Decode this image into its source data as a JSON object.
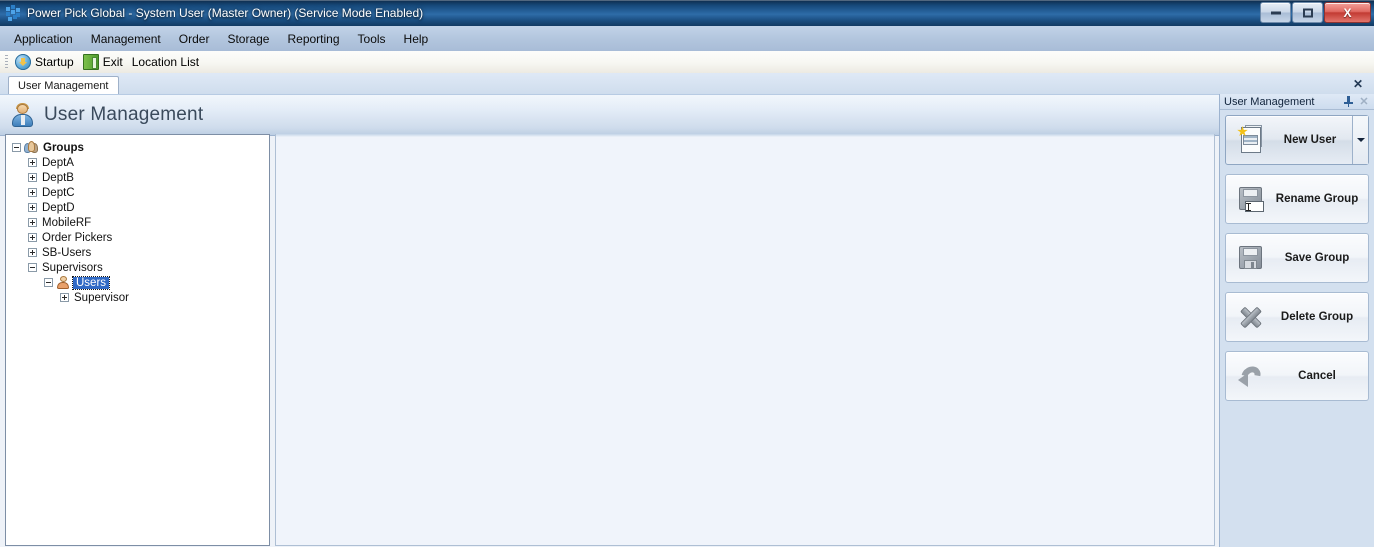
{
  "window": {
    "title": "Power Pick Global - System User (Master Owner) (Service Mode Enabled)",
    "icon": "app-grid-icon",
    "controls": {
      "minimize": "minimize-button",
      "maximize": "restore-button",
      "close_label": "X"
    }
  },
  "menubar": {
    "items": [
      {
        "label": "Application"
      },
      {
        "label": "Management"
      },
      {
        "label": "Order"
      },
      {
        "label": "Storage"
      },
      {
        "label": "Reporting"
      },
      {
        "label": "Tools"
      },
      {
        "label": "Help"
      }
    ]
  },
  "toolbar": {
    "items": [
      {
        "label": "Startup",
        "icon": "startup-icon"
      },
      {
        "label": "Exit",
        "icon": "exit-door-icon"
      },
      {
        "label": "Location List",
        "icon": "none"
      }
    ]
  },
  "tabs": {
    "items": [
      {
        "label": "User Management",
        "active": true
      }
    ],
    "close_label": "✕"
  },
  "page_header": {
    "title": "User Management",
    "icon": "user-avatar-icon"
  },
  "tree": {
    "nodes": [
      {
        "label": "Groups",
        "indent": 0,
        "expander": "minus",
        "icon": "groups-icon",
        "bold": true,
        "selected": false
      },
      {
        "label": "DeptA",
        "indent": 1,
        "expander": "plus",
        "icon": "none",
        "bold": false,
        "selected": false
      },
      {
        "label": "DeptB",
        "indent": 1,
        "expander": "plus",
        "icon": "none",
        "bold": false,
        "selected": false
      },
      {
        "label": "DeptC",
        "indent": 1,
        "expander": "plus",
        "icon": "none",
        "bold": false,
        "selected": false
      },
      {
        "label": "DeptD",
        "indent": 1,
        "expander": "plus",
        "icon": "none",
        "bold": false,
        "selected": false
      },
      {
        "label": "MobileRF",
        "indent": 1,
        "expander": "plus",
        "icon": "none",
        "bold": false,
        "selected": false
      },
      {
        "label": "Order Pickers",
        "indent": 1,
        "expander": "plus",
        "icon": "none",
        "bold": false,
        "selected": false
      },
      {
        "label": "SB-Users",
        "indent": 1,
        "expander": "plus",
        "icon": "none",
        "bold": false,
        "selected": false
      },
      {
        "label": "Supervisors",
        "indent": 1,
        "expander": "minus",
        "icon": "none",
        "bold": false,
        "selected": false
      },
      {
        "label": "Users",
        "indent": 2,
        "expander": "minus",
        "icon": "user-icon",
        "bold": false,
        "selected": true
      },
      {
        "label": "Supervisor",
        "indent": 3,
        "expander": "plus",
        "icon": "none",
        "bold": false,
        "selected": false
      }
    ]
  },
  "dock": {
    "title": "User Management",
    "pin_icon": "pin-icon",
    "close_label": "✕",
    "buttons": [
      {
        "label": "New User",
        "icon": "new-user-icon",
        "split": true
      },
      {
        "label": "Rename Group",
        "icon": "rename-floppy-icon",
        "split": false
      },
      {
        "label": "Save Group",
        "icon": "save-floppy-icon",
        "split": false
      },
      {
        "label": "Delete Group",
        "icon": "delete-x-icon",
        "split": false
      },
      {
        "label": "Cancel",
        "icon": "undo-arrow-icon",
        "split": false
      }
    ]
  },
  "colors": {
    "titlebar": "#174a7c",
    "menubar": "#b3c6de",
    "selection": "#316ac5",
    "dock_bg": "#d3e0ef",
    "content_bg": "#f0f4fb",
    "close_red": "#c23b33"
  }
}
